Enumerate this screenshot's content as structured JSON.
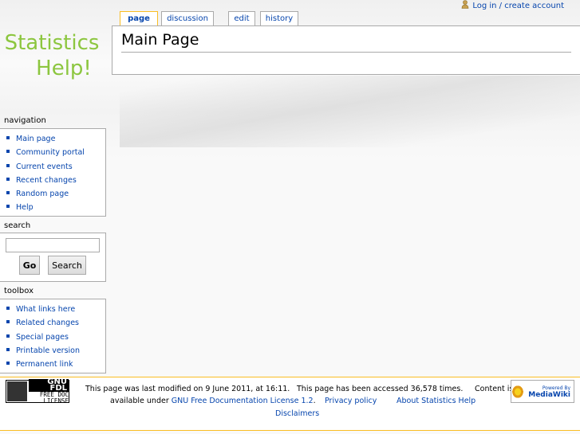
{
  "logo": {
    "line1": "Statistics",
    "line2": "Help!"
  },
  "personal": {
    "login": "Log in / create account"
  },
  "tabs": [
    {
      "label": "page"
    },
    {
      "label": "discussion"
    },
    {
      "label": "edit"
    },
    {
      "label": "history"
    }
  ],
  "content": {
    "heading": "Main Page"
  },
  "navigation": {
    "title": "navigation",
    "items": [
      "Main page",
      "Community portal",
      "Current events",
      "Recent changes",
      "Random page",
      "Help"
    ]
  },
  "search": {
    "title": "search",
    "go": "Go",
    "search": "Search",
    "value": ""
  },
  "toolbox": {
    "title": "toolbox",
    "items": [
      "What links here",
      "Related changes",
      "Special pages",
      "Printable version",
      "Permanent link"
    ]
  },
  "footer": {
    "gnu_line1": "GNU FDL",
    "gnu_line2": "FREE DOC",
    "gnu_line3": "LICENSE",
    "powered_line1": "Powered By",
    "powered_line2": "MediaWiki",
    "lastmod": "This page was last modified on 9 June 2011, at 16:11.",
    "viewcount": "This page has been accessed 36,578 times.",
    "copyright_prefix": "Content is",
    "available_under": "available under",
    "license_link": "GNU Free Documentation License 1.2",
    "period": ".",
    "privacy": "Privacy policy",
    "about": "About Statistics Help",
    "disclaimers": "Disclaimers"
  }
}
